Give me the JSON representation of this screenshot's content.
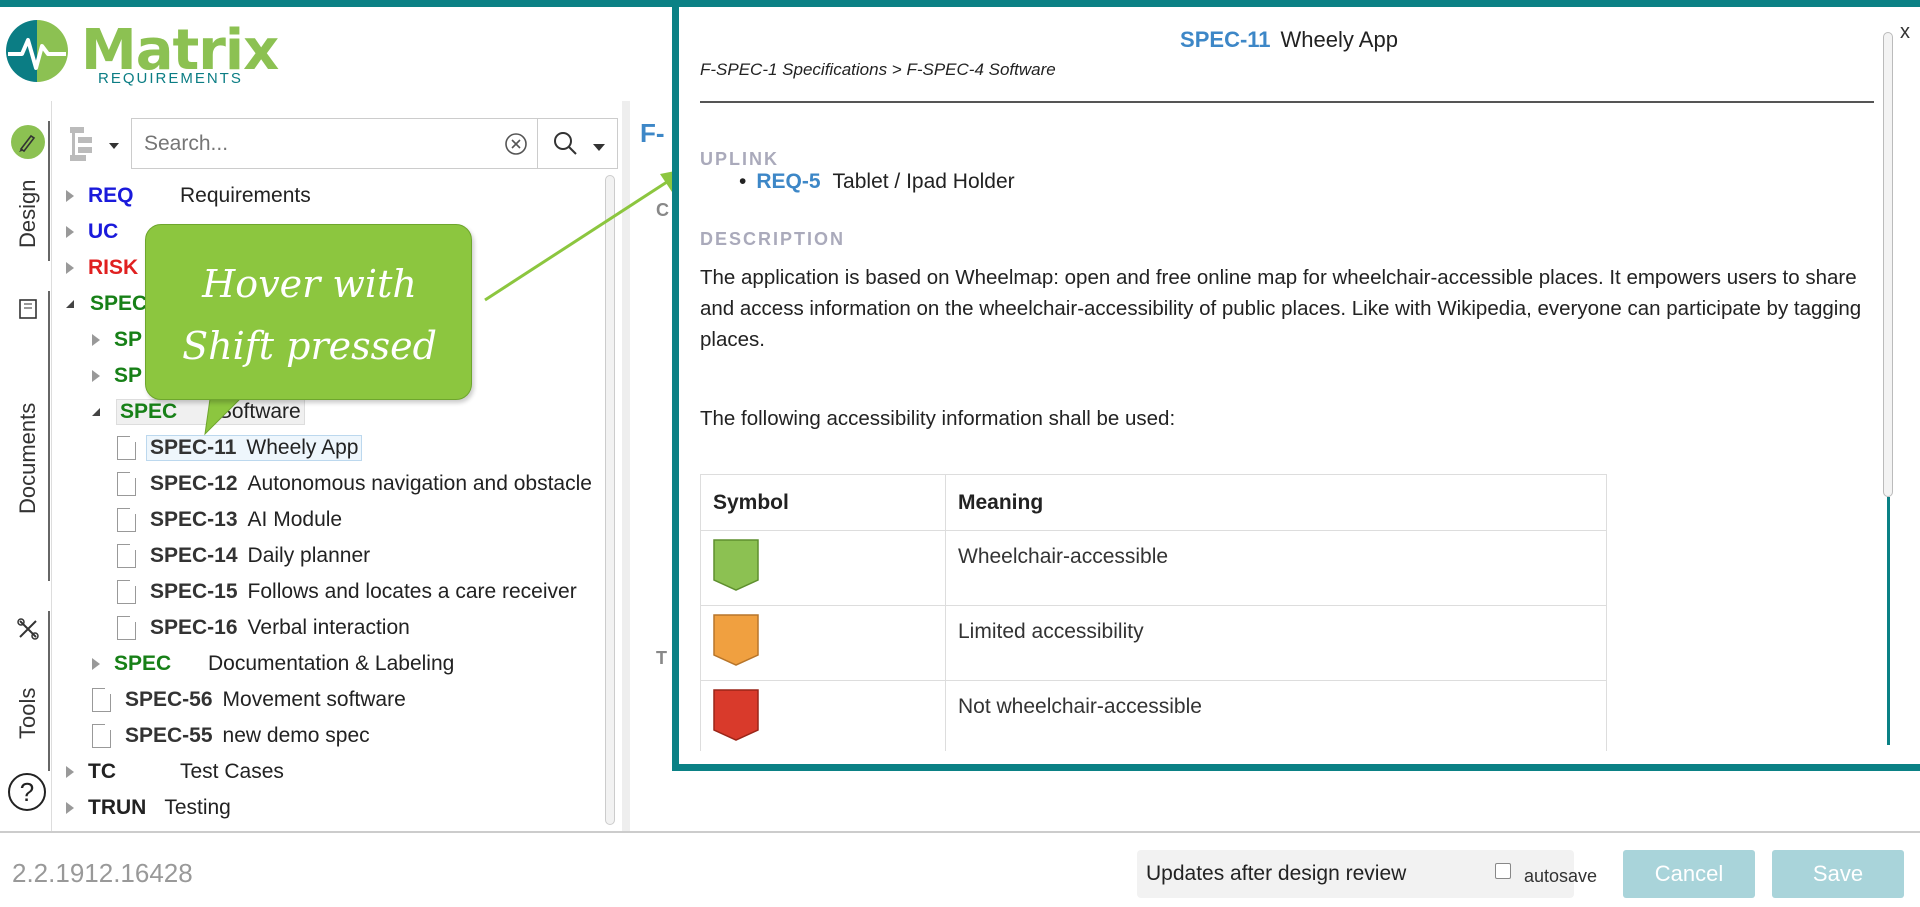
{
  "app": {
    "logo_word": "Matrix",
    "logo_sub": "REQUIREMENTS"
  },
  "nav": {
    "design": "Design",
    "documents": "Documents",
    "tools": "Tools",
    "help": "?"
  },
  "search": {
    "placeholder": "Search..."
  },
  "tree": {
    "categories": [
      {
        "key": "REQ",
        "label": "Requirements",
        "color": "#1a1adb"
      },
      {
        "key": "UC",
        "label": "",
        "color": "#1a1adb"
      },
      {
        "key": "RISK",
        "label": "",
        "color": "#e02020"
      },
      {
        "key": "SPEC",
        "label": "",
        "color": "#178017"
      }
    ],
    "spec_folders": [
      {
        "key": "SP",
        "label": ""
      },
      {
        "key": "SP",
        "label": ""
      },
      {
        "key": "SPEC",
        "label": "Software"
      }
    ],
    "spec_items": [
      {
        "key": "SPEC-11",
        "label": "Wheely App"
      },
      {
        "key": "SPEC-12",
        "label": "Autonomous navigation and obstacle"
      },
      {
        "key": "SPEC-13",
        "label": "AI Module"
      },
      {
        "key": "SPEC-14",
        "label": "Daily planner"
      },
      {
        "key": "SPEC-15",
        "label": "Follows and locates a care receiver"
      },
      {
        "key": "SPEC-16",
        "label": "Verbal interaction"
      }
    ],
    "doc_folder": {
      "key": "SPEC",
      "label": "Documentation & Labeling"
    },
    "loose_items": [
      {
        "key": "SPEC-56",
        "label": "Movement software"
      },
      {
        "key": "SPEC-55",
        "label": "new demo spec"
      }
    ],
    "bottom": [
      {
        "key": "TC",
        "label": "Test Cases"
      },
      {
        "key": "TRUN",
        "label": "Testing"
      }
    ]
  },
  "background": {
    "title_frag": "F-",
    "c_frag": "C",
    "t_frag": "T"
  },
  "callout": {
    "line1": "Hover with",
    "line2": "Shift pressed"
  },
  "popup": {
    "close": "x",
    "key": "SPEC-11",
    "title": "Wheely App",
    "breadcrumb": "F-SPEC-1 Specifications > F-SPEC-4 Software",
    "uplink_heading": "UPLINK",
    "uplink": {
      "key": "REQ-5",
      "label": "Tablet / Ipad Holder"
    },
    "description_heading": "DESCRIPTION",
    "description": "The application is based on Wheelmap: open and free online map for wheelchair-accessible places. It empowers users to share and access information on the wheelchair-accessibility of public places. Like with Wikipedia, everyone can participate by tagging places.",
    "following": "The following accessibility information shall be used:",
    "table": {
      "headers": [
        "Symbol",
        "Meaning"
      ],
      "rows": [
        {
          "color": "#8cc152",
          "meaning": "Wheelchair-accessible"
        },
        {
          "color": "#f0a040",
          "meaning": "Limited accessibility"
        },
        {
          "color": "#d93a2b",
          "meaning": "Not wheelchair-accessible"
        }
      ]
    }
  },
  "footer": {
    "version": "2.2.1912.16428",
    "comment": "Updates after design review",
    "autosave": "autosave",
    "cancel": "Cancel",
    "save": "Save"
  }
}
